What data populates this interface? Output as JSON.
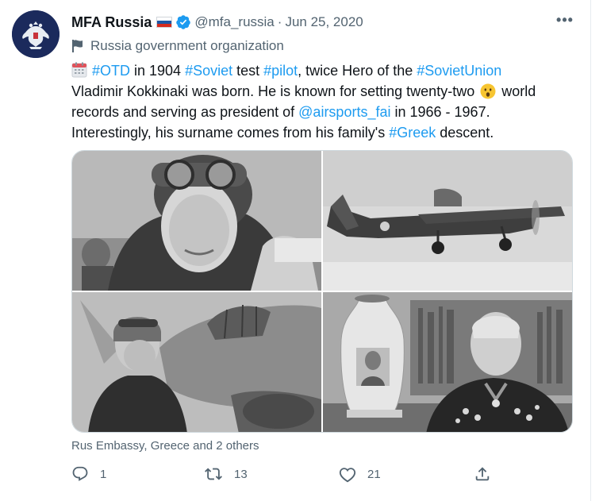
{
  "tweet": {
    "author_name": "MFA Russia",
    "handle": "@mfa_russia",
    "separator": "·",
    "date": "Jun 25, 2020",
    "org_label": "Russia government organization",
    "more_label": "•••",
    "text": {
      "l1_tag1": "#OTD",
      "l1_t1": " in 1904 ",
      "l1_tag2": "#Soviet",
      "l1_t2": " test ",
      "l1_tag3": "#pilot",
      "l1_t3": ", twice Hero of the ",
      "l1_tag4": "#SovietUnion",
      "l2_t1": "Vladimir Kokkinaki was born. He is known for setting twenty-two ",
      "l2_t2": " world",
      "l3_t1": "records and serving as president of ",
      "l3_tag1": "@airsports_fai",
      "l3_t2": " in 1966 - 1967.",
      "l4_t1": "Interestingly, his surname comes from his family's ",
      "l4_tag1": "#Greek",
      "l4_t2": " descent."
    },
    "tagged_people": "Rus Embassy, Greece and 2 others",
    "actions": {
      "reply_count": "1",
      "retweet_count": "13",
      "like_count": "21"
    }
  },
  "colors": {
    "link": "#1d9bf0",
    "secondary_text": "#536471",
    "primary_text": "#0f1419",
    "verified": "#1d9bf0",
    "border": "#cfd9de"
  },
  "icons": {
    "verified": "verified-badge-icon",
    "flag": "russia-flag-icon",
    "org": "government-flag-icon",
    "calendar": "calendar-emoji-icon",
    "face": "surprised-face-emoji-icon",
    "reply": "reply-icon",
    "retweet": "retweet-icon",
    "like": "heart-icon",
    "share": "share-icon"
  }
}
